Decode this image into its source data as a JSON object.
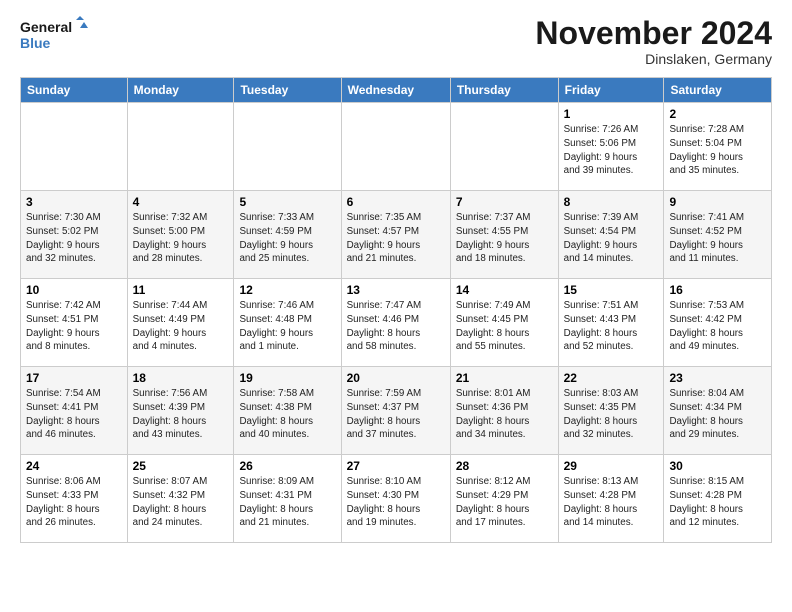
{
  "header": {
    "logo_line1": "General",
    "logo_line2": "Blue",
    "month_title": "November 2024",
    "subtitle": "Dinslaken, Germany"
  },
  "days_of_week": [
    "Sunday",
    "Monday",
    "Tuesday",
    "Wednesday",
    "Thursday",
    "Friday",
    "Saturday"
  ],
  "weeks": [
    [
      {
        "day": "",
        "info": ""
      },
      {
        "day": "",
        "info": ""
      },
      {
        "day": "",
        "info": ""
      },
      {
        "day": "",
        "info": ""
      },
      {
        "day": "",
        "info": ""
      },
      {
        "day": "1",
        "info": "Sunrise: 7:26 AM\nSunset: 5:06 PM\nDaylight: 9 hours\nand 39 minutes."
      },
      {
        "day": "2",
        "info": "Sunrise: 7:28 AM\nSunset: 5:04 PM\nDaylight: 9 hours\nand 35 minutes."
      }
    ],
    [
      {
        "day": "3",
        "info": "Sunrise: 7:30 AM\nSunset: 5:02 PM\nDaylight: 9 hours\nand 32 minutes."
      },
      {
        "day": "4",
        "info": "Sunrise: 7:32 AM\nSunset: 5:00 PM\nDaylight: 9 hours\nand 28 minutes."
      },
      {
        "day": "5",
        "info": "Sunrise: 7:33 AM\nSunset: 4:59 PM\nDaylight: 9 hours\nand 25 minutes."
      },
      {
        "day": "6",
        "info": "Sunrise: 7:35 AM\nSunset: 4:57 PM\nDaylight: 9 hours\nand 21 minutes."
      },
      {
        "day": "7",
        "info": "Sunrise: 7:37 AM\nSunset: 4:55 PM\nDaylight: 9 hours\nand 18 minutes."
      },
      {
        "day": "8",
        "info": "Sunrise: 7:39 AM\nSunset: 4:54 PM\nDaylight: 9 hours\nand 14 minutes."
      },
      {
        "day": "9",
        "info": "Sunrise: 7:41 AM\nSunset: 4:52 PM\nDaylight: 9 hours\nand 11 minutes."
      }
    ],
    [
      {
        "day": "10",
        "info": "Sunrise: 7:42 AM\nSunset: 4:51 PM\nDaylight: 9 hours\nand 8 minutes."
      },
      {
        "day": "11",
        "info": "Sunrise: 7:44 AM\nSunset: 4:49 PM\nDaylight: 9 hours\nand 4 minutes."
      },
      {
        "day": "12",
        "info": "Sunrise: 7:46 AM\nSunset: 4:48 PM\nDaylight: 9 hours\nand 1 minute."
      },
      {
        "day": "13",
        "info": "Sunrise: 7:47 AM\nSunset: 4:46 PM\nDaylight: 8 hours\nand 58 minutes."
      },
      {
        "day": "14",
        "info": "Sunrise: 7:49 AM\nSunset: 4:45 PM\nDaylight: 8 hours\nand 55 minutes."
      },
      {
        "day": "15",
        "info": "Sunrise: 7:51 AM\nSunset: 4:43 PM\nDaylight: 8 hours\nand 52 minutes."
      },
      {
        "day": "16",
        "info": "Sunrise: 7:53 AM\nSunset: 4:42 PM\nDaylight: 8 hours\nand 49 minutes."
      }
    ],
    [
      {
        "day": "17",
        "info": "Sunrise: 7:54 AM\nSunset: 4:41 PM\nDaylight: 8 hours\nand 46 minutes."
      },
      {
        "day": "18",
        "info": "Sunrise: 7:56 AM\nSunset: 4:39 PM\nDaylight: 8 hours\nand 43 minutes."
      },
      {
        "day": "19",
        "info": "Sunrise: 7:58 AM\nSunset: 4:38 PM\nDaylight: 8 hours\nand 40 minutes."
      },
      {
        "day": "20",
        "info": "Sunrise: 7:59 AM\nSunset: 4:37 PM\nDaylight: 8 hours\nand 37 minutes."
      },
      {
        "day": "21",
        "info": "Sunrise: 8:01 AM\nSunset: 4:36 PM\nDaylight: 8 hours\nand 34 minutes."
      },
      {
        "day": "22",
        "info": "Sunrise: 8:03 AM\nSunset: 4:35 PM\nDaylight: 8 hours\nand 32 minutes."
      },
      {
        "day": "23",
        "info": "Sunrise: 8:04 AM\nSunset: 4:34 PM\nDaylight: 8 hours\nand 29 minutes."
      }
    ],
    [
      {
        "day": "24",
        "info": "Sunrise: 8:06 AM\nSunset: 4:33 PM\nDaylight: 8 hours\nand 26 minutes."
      },
      {
        "day": "25",
        "info": "Sunrise: 8:07 AM\nSunset: 4:32 PM\nDaylight: 8 hours\nand 24 minutes."
      },
      {
        "day": "26",
        "info": "Sunrise: 8:09 AM\nSunset: 4:31 PM\nDaylight: 8 hours\nand 21 minutes."
      },
      {
        "day": "27",
        "info": "Sunrise: 8:10 AM\nSunset: 4:30 PM\nDaylight: 8 hours\nand 19 minutes."
      },
      {
        "day": "28",
        "info": "Sunrise: 8:12 AM\nSunset: 4:29 PM\nDaylight: 8 hours\nand 17 minutes."
      },
      {
        "day": "29",
        "info": "Sunrise: 8:13 AM\nSunset: 4:28 PM\nDaylight: 8 hours\nand 14 minutes."
      },
      {
        "day": "30",
        "info": "Sunrise: 8:15 AM\nSunset: 4:28 PM\nDaylight: 8 hours\nand 12 minutes."
      }
    ]
  ],
  "accent_color": "#3a7abf"
}
